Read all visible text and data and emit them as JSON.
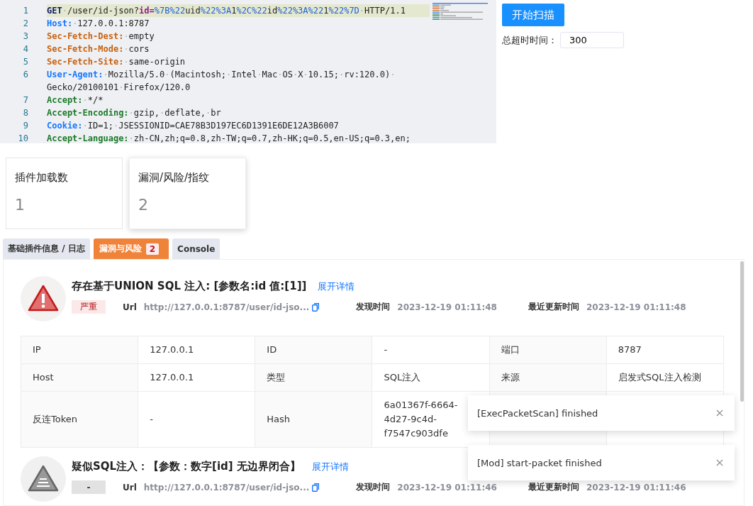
{
  "editor": {
    "lines": [
      {
        "number": "1",
        "highlighted": true,
        "segments": [
          {
            "kind": "method",
            "text": "GET"
          },
          {
            "kind": "space",
            "text": "·"
          },
          {
            "kind": "text",
            "text": "/user/id-json?"
          },
          {
            "kind": "param",
            "text": "id="
          },
          {
            "kind": "encoded",
            "text": "%7B%22"
          },
          {
            "kind": "text",
            "text": "uid"
          },
          {
            "kind": "encoded",
            "text": "%22%3A"
          },
          {
            "kind": "text",
            "text": "1"
          },
          {
            "kind": "encoded",
            "text": "%2C%22"
          },
          {
            "kind": "text",
            "text": "id"
          },
          {
            "kind": "encoded",
            "text": "%22%3A%22"
          },
          {
            "kind": "text",
            "text": "1"
          },
          {
            "kind": "encoded",
            "text": "%22%7D"
          },
          {
            "kind": "space",
            "text": "·"
          },
          {
            "kind": "text",
            "text": "HTTP/1.1"
          }
        ]
      },
      {
        "number": "2",
        "highlighted": false,
        "segments": [
          {
            "kind": "key-blue",
            "text": "Host:"
          },
          {
            "kind": "space",
            "text": "·"
          },
          {
            "kind": "text",
            "text": "127.0.0.1:8787"
          }
        ]
      },
      {
        "number": "3",
        "highlighted": false,
        "segments": [
          {
            "kind": "key-orange",
            "text": "Sec-Fetch-Dest:"
          },
          {
            "kind": "space",
            "text": "·"
          },
          {
            "kind": "text",
            "text": "empty"
          }
        ]
      },
      {
        "number": "4",
        "highlighted": false,
        "segments": [
          {
            "kind": "key-orange",
            "text": "Sec-Fetch-Mode:"
          },
          {
            "kind": "space",
            "text": "·"
          },
          {
            "kind": "text",
            "text": "cors"
          }
        ]
      },
      {
        "number": "5",
        "highlighted": false,
        "segments": [
          {
            "kind": "key-orange",
            "text": "Sec-Fetch-Site:"
          },
          {
            "kind": "space",
            "text": "·"
          },
          {
            "kind": "text",
            "text": "same-origin"
          }
        ]
      },
      {
        "number": "6",
        "highlighted": false,
        "segments": [
          {
            "kind": "key-blue",
            "text": "User-Agent:"
          },
          {
            "kind": "space",
            "text": "·"
          },
          {
            "kind": "text",
            "text": "Mozilla/5.0"
          },
          {
            "kind": "space",
            "text": "·"
          },
          {
            "kind": "text",
            "text": "(Macintosh;"
          },
          {
            "kind": "space",
            "text": "·"
          },
          {
            "kind": "text",
            "text": "Intel"
          },
          {
            "kind": "space",
            "text": "·"
          },
          {
            "kind": "text",
            "text": "Mac"
          },
          {
            "kind": "space",
            "text": "·"
          },
          {
            "kind": "text",
            "text": "OS"
          },
          {
            "kind": "space",
            "text": "·"
          },
          {
            "kind": "text",
            "text": "X"
          },
          {
            "kind": "space",
            "text": "·"
          },
          {
            "kind": "text",
            "text": "10.15;"
          },
          {
            "kind": "space",
            "text": "·"
          },
          {
            "kind": "text",
            "text": "rv:120.0)"
          },
          {
            "kind": "space",
            "text": "·"
          },
          {
            "kind": "text",
            "text": "Gecko/20100101"
          },
          {
            "kind": "space",
            "text": "·"
          },
          {
            "kind": "text",
            "text": "Firefox/120.0"
          }
        ]
      },
      {
        "number": "7",
        "highlighted": false,
        "segments": [
          {
            "kind": "key-green",
            "text": "Accept:"
          },
          {
            "kind": "space",
            "text": "·"
          },
          {
            "kind": "text",
            "text": "*/*"
          }
        ]
      },
      {
        "number": "8",
        "highlighted": false,
        "segments": [
          {
            "kind": "key-green",
            "text": "Accept-Encoding:"
          },
          {
            "kind": "space",
            "text": "·"
          },
          {
            "kind": "text",
            "text": "gzip,"
          },
          {
            "kind": "space",
            "text": "·"
          },
          {
            "kind": "text",
            "text": "deflate,"
          },
          {
            "kind": "space",
            "text": "·"
          },
          {
            "kind": "text",
            "text": "br"
          }
        ]
      },
      {
        "number": "9",
        "highlighted": false,
        "segments": [
          {
            "kind": "key-blue",
            "text": "Cookie:"
          },
          {
            "kind": "space",
            "text": "·"
          },
          {
            "kind": "text",
            "text": "ID=1;"
          },
          {
            "kind": "space",
            "text": "·"
          },
          {
            "kind": "text",
            "text": "JSESSIONID=CAE78B3D197EC6D1391E6DE12A3B6007"
          }
        ]
      },
      {
        "number": "10",
        "highlighted": false,
        "segments": [
          {
            "kind": "key-green",
            "text": "Accept-Language:"
          },
          {
            "kind": "space",
            "text": "·"
          },
          {
            "kind": "text",
            "text": "zh-CN,zh;q=0.8,zh-TW;q=0.7,zh-HK;q=0.5,en-US;q=0.3,en;"
          }
        ]
      }
    ]
  },
  "scan_button": "开始扫描",
  "timeout": {
    "label": "总超时时间：",
    "value": "300"
  },
  "stats": [
    {
      "title": "插件加载数",
      "value": "1",
      "hovered": false
    },
    {
      "title": "漏洞/风险/指纹",
      "value": "2",
      "hovered": true
    }
  ],
  "tabs": [
    {
      "label": "基础插件信息 / 日志",
      "selected": false
    },
    {
      "label": "漏洞与风险",
      "badge": "2",
      "selected": true
    },
    {
      "label": "Console",
      "selected": false
    }
  ],
  "risks": [
    {
      "kind": "critical",
      "severity_label": "严重",
      "title": "存在基于UNION SQL 注入: [参数名:id 值:[1]]",
      "expand_link": "展开详情",
      "url_label": "Url",
      "url": "http://127.0.0.1:8787/user/id-jso...",
      "found_label": "发现时间",
      "found_time": "2023-12-19 01:11:48",
      "updated_label": "最近更新时间",
      "updated_time": "2023-12-19 01:11:48",
      "details": [
        [
          {
            "label": "IP",
            "value": "127.0.0.1"
          },
          {
            "label": "ID",
            "value": "-"
          },
          {
            "label": "端口",
            "value": "8787"
          }
        ],
        [
          {
            "label": "Host",
            "value": "127.0.0.1"
          },
          {
            "label": "类型",
            "value": "SQL注入"
          },
          {
            "label": "来源",
            "value": "启发式SQL注入检测"
          }
        ],
        [
          {
            "label": "反连Token",
            "value": "-"
          },
          {
            "label": "Hash",
            "value": "6a01367f-6664-4d27-9c4d-f7547c903dfe"
          }
        ]
      ]
    },
    {
      "kind": "unknown",
      "severity_label": "-",
      "title": "疑似SQL注入：【参数：数字[id] 无边界闭合】",
      "expand_link": "展开详情",
      "url_label": "Url",
      "url": "http://127.0.0.1:8787/user/id-jso...",
      "found_label": "发现时间",
      "found_time": "2023-12-19 01:11:46",
      "updated_label": "最近更新时间",
      "updated_time": "2023-12-19 01:11:46"
    }
  ],
  "toasts": [
    {
      "message": "[ExecPacketScan] finished"
    },
    {
      "message": "[Mod] start-packet finished"
    }
  ]
}
